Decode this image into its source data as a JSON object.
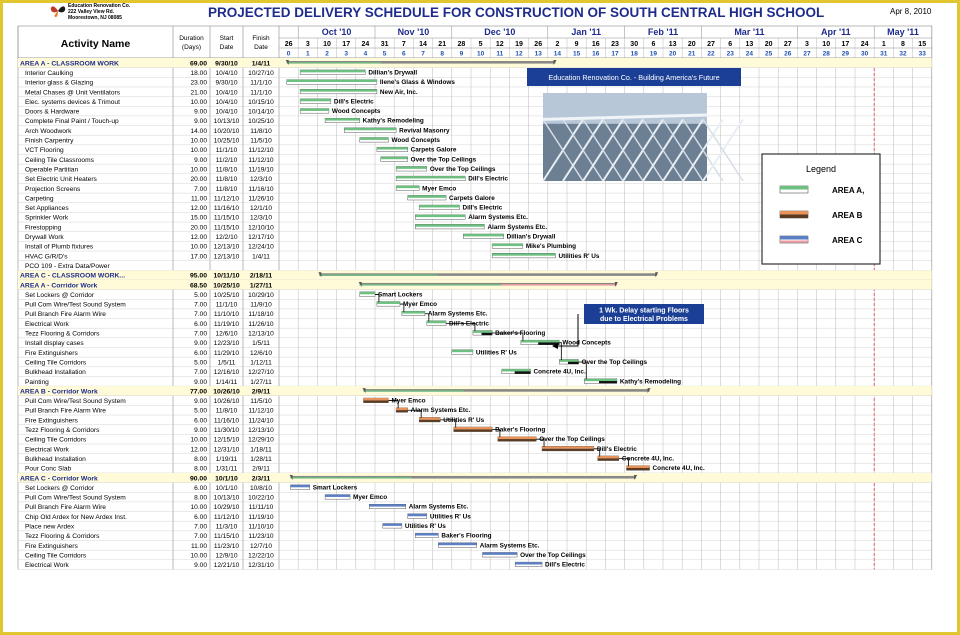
{
  "company": {
    "name": "Education Renovation Co.",
    "address": "222 Valley View Rd.",
    "city": "Moorestown, NJ  08085"
  },
  "title": "PROJECTED DELIVERY SCHEDULE FOR CONSTRUCTION OF SOUTH CENTRAL HIGH SCHOOL",
  "date": "Apr 8, 2010",
  "headers": {
    "activity": "Activity Name",
    "duration": "Duration (Days)",
    "start": "Start Date",
    "finish": "Finish Date"
  },
  "months": [
    {
      "label": "Oct '10",
      "col": 1
    },
    {
      "label": "Nov '10",
      "col": 5
    },
    {
      "label": "Dec '10",
      "col": 9
    },
    {
      "label": "Jan '11",
      "col": 14
    },
    {
      "label": "Feb '11",
      "col": 18
    },
    {
      "label": "Mar '11",
      "col": 22
    },
    {
      "label": "Apr '11",
      "col": 27
    },
    {
      "label": "May '11",
      "col": 31
    }
  ],
  "day_labels": [
    "26",
    "3",
    "10",
    "17",
    "24",
    "31",
    "7",
    "14",
    "21",
    "28",
    "5",
    "12",
    "19",
    "26",
    "2",
    "9",
    "16",
    "23",
    "30",
    "6",
    "13",
    "20",
    "27",
    "6",
    "13",
    "20",
    "27",
    "3",
    "10",
    "17",
    "24",
    "1",
    "8",
    "15"
  ],
  "week_labels": [
    "0",
    "1",
    "2",
    "3",
    "4",
    "5",
    "6",
    "7",
    "8",
    "9",
    "10",
    "11",
    "12",
    "13",
    "14",
    "15",
    "16",
    "17",
    "18",
    "19",
    "20",
    "21",
    "22",
    "23",
    "24",
    "25",
    "26",
    "27",
    "28",
    "29",
    "30",
    "31",
    "32",
    "33"
  ],
  "rows": [
    {
      "name": "AREA A - CLASSROOM WORK",
      "dur": "69.00",
      "start": "9/30/10",
      "finish": "1/4/11",
      "type": "summary",
      "bar": [
        0.4,
        14.4
      ],
      "label": ""
    },
    {
      "name": "Interior Caulking",
      "dur": "18.00",
      "start": "10/4/10",
      "finish": "10/27/10",
      "type": "a",
      "bar": [
        1.1,
        4.5
      ],
      "label": "Dillian's Drywall"
    },
    {
      "name": "Interior glass & Glazing",
      "dur": "23.00",
      "start": "9/30/10",
      "finish": "11/1/10",
      "type": "a",
      "bar": [
        0.4,
        5.1
      ],
      "label": "Ilene's Glass & Windows"
    },
    {
      "name": "Metal Chases @ Unit Ventilators",
      "dur": "21.00",
      "start": "10/4/10",
      "finish": "11/1/10",
      "type": "a",
      "bar": [
        1.1,
        5.1
      ],
      "label": "New Air, Inc."
    },
    {
      "name": "Elec. systems devices & Trimout",
      "dur": "10.00",
      "start": "10/4/10",
      "finish": "10/15/10",
      "type": "a",
      "bar": [
        1.1,
        2.7
      ],
      "label": "Dill's Electric"
    },
    {
      "name": "Doors & Hardware",
      "dur": "9.00",
      "start": "10/4/10",
      "finish": "10/14/10",
      "type": "a",
      "bar": [
        1.1,
        2.6
      ],
      "label": "Wood Concepts"
    },
    {
      "name": "Complete Final Paint / Touch-up",
      "dur": "9.00",
      "start": "10/13/10",
      "finish": "10/25/10",
      "type": "a",
      "bar": [
        2.4,
        4.2
      ],
      "label": "Kathy's Remodeling"
    },
    {
      "name": "Arch Woodwork",
      "dur": "14.00",
      "start": "10/20/10",
      "finish": "11/8/10",
      "type": "a",
      "bar": [
        3.4,
        6.1
      ],
      "label": "Revival Masonry"
    },
    {
      "name": "Finish Carpentry",
      "dur": "10.00",
      "start": "10/25/10",
      "finish": "11/5/10",
      "type": "a",
      "bar": [
        4.2,
        5.7
      ],
      "label": "Wood Concepts"
    },
    {
      "name": "VCT Flooring",
      "dur": "10.00",
      "start": "11/1/10",
      "finish": "11/12/10",
      "type": "a",
      "bar": [
        5.1,
        6.7
      ],
      "label": "Carpets Galore"
    },
    {
      "name": "Ceiling Tile Classrooms",
      "dur": "9.00",
      "start": "11/2/10",
      "finish": "11/12/10",
      "type": "a",
      "bar": [
        5.3,
        6.7
      ],
      "label": "Over the Top Ceilings"
    },
    {
      "name": "Operable Partitian",
      "dur": "10.00",
      "start": "11/8/10",
      "finish": "11/19/10",
      "type": "a",
      "bar": [
        6.1,
        7.7
      ],
      "label": "Over the Top Ceilings"
    },
    {
      "name": "Set Electric Unit Heaters",
      "dur": "20.00",
      "start": "11/8/10",
      "finish": "12/3/10",
      "type": "a",
      "bar": [
        6.1,
        9.7
      ],
      "label": "Dill's Electric"
    },
    {
      "name": "Projection Screens",
      "dur": "7.00",
      "start": "11/8/10",
      "finish": "11/16/10",
      "type": "a",
      "bar": [
        6.1,
        7.3
      ],
      "label": "Myer Emco"
    },
    {
      "name": "Carpeting",
      "dur": "11.00",
      "start": "11/12/10",
      "finish": "11/26/10",
      "type": "a",
      "bar": [
        6.7,
        8.7
      ],
      "label": "Carpets Galore"
    },
    {
      "name": "Set Appliances",
      "dur": "12.00",
      "start": "11/16/10",
      "finish": "12/1/10",
      "type": "a",
      "bar": [
        7.3,
        9.4
      ],
      "label": "Dill's Electric"
    },
    {
      "name": "Sprinkler Work",
      "dur": "15.00",
      "start": "11/15/10",
      "finish": "12/3/10",
      "type": "a",
      "bar": [
        7.1,
        9.7
      ],
      "label": "Alarm Systems Etc."
    },
    {
      "name": "Firestopping",
      "dur": "20.00",
      "start": "11/15/10",
      "finish": "12/10/10",
      "type": "a",
      "bar": [
        7.1,
        10.7
      ],
      "label": "Alarm Systems Etc."
    },
    {
      "name": "Drywall Work",
      "dur": "12.00",
      "start": "12/2/10",
      "finish": "12/17/10",
      "type": "a",
      "bar": [
        9.6,
        11.7
      ],
      "label": "Dillian's Drywall"
    },
    {
      "name": "Install of Plumb fixtures",
      "dur": "10.00",
      "start": "12/13/10",
      "finish": "12/24/10",
      "type": "a",
      "bar": [
        11.1,
        12.7
      ],
      "label": "Mike's Plumbing"
    },
    {
      "name": "HVAC G/R/D's",
      "dur": "17.00",
      "start": "12/13/10",
      "finish": "1/4/11",
      "type": "a",
      "bar": [
        11.1,
        14.4
      ],
      "label": "Utilities R' Us"
    },
    {
      "name": "PCO 109 - Extra Data/Power",
      "dur": "",
      "start": "",
      "finish": "",
      "type": "plain",
      "bar": null,
      "label": ""
    },
    {
      "name": "AREA C - CLASSROOM WORK...",
      "dur": "95.00",
      "start": "10/11/10",
      "finish": "2/18/11",
      "type": "summary",
      "bar": [
        2.1,
        19.7
      ],
      "label": ""
    },
    {
      "name": "AREA A - Corridor Work",
      "dur": "68.50",
      "start": "10/25/10",
      "finish": "1/27/11",
      "type": "summary2",
      "bar": [
        4.2,
        17.6
      ],
      "label": ""
    },
    {
      "name": "Set Lockers @ Corridor",
      "dur": "5.00",
      "start": "10/25/10",
      "finish": "10/29/10",
      "type": "a",
      "bar": [
        4.2,
        5.0
      ],
      "label": "Smart Lockers"
    },
    {
      "name": "Pull Com Wire/Test Sound System",
      "dur": "7.00",
      "start": "11/1/10",
      "finish": "11/9/10",
      "type": "a",
      "bar": [
        5.1,
        6.3
      ],
      "label": "Myer Emco"
    },
    {
      "name": "Pull Branch Fire Alarm Wire",
      "dur": "7.00",
      "start": "11/10/10",
      "finish": "11/18/10",
      "type": "a",
      "bar": [
        6.4,
        7.6
      ],
      "label": "Alarm Systems Etc."
    },
    {
      "name": "Electrical Work",
      "dur": "6.00",
      "start": "11/19/10",
      "finish": "11/26/10",
      "type": "a",
      "bar": [
        7.7,
        8.7
      ],
      "label": "Dill's Electric"
    },
    {
      "name": "Tezz Flooring & Corridors",
      "dur": "7.00",
      "start": "12/6/10",
      "finish": "12/13/10",
      "type": "crit",
      "bar": [
        10.1,
        11.1
      ],
      "label": "Baker's Flooring"
    },
    {
      "name": "Install display cases",
      "dur": "9.00",
      "start": "12/23/10",
      "finish": "1/5/11",
      "type": "crit",
      "bar": [
        12.6,
        14.6
      ],
      "label": "Wood Concepts"
    },
    {
      "name": "Fire Extinguishers",
      "dur": "6.00",
      "start": "11/29/10",
      "finish": "12/6/10",
      "type": "a",
      "bar": [
        9.0,
        10.1
      ],
      "label": "Utilities R' Us"
    },
    {
      "name": "Ceiling Tile Corridors",
      "dur": "5.00",
      "start": "1/5/11",
      "finish": "1/12/11",
      "type": "crit",
      "bar": [
        14.6,
        15.6
      ],
      "label": "Over the Top Ceilings"
    },
    {
      "name": "Bulkhead Installation",
      "dur": "7.00",
      "start": "12/16/10",
      "finish": "12/27/10",
      "type": "crit",
      "bar": [
        11.6,
        13.1
      ],
      "label": "Concrete 4U, Inc."
    },
    {
      "name": "Painting",
      "dur": "9.00",
      "start": "1/14/11",
      "finish": "1/27/11",
      "type": "crit",
      "bar": [
        15.9,
        17.6
      ],
      "label": "Kathy's Remodeling"
    },
    {
      "name": "AREA B - Corridor Work",
      "dur": "77.00",
      "start": "10/26/10",
      "finish": "2/9/11",
      "type": "summary",
      "bar": [
        4.4,
        19.3
      ],
      "label": ""
    },
    {
      "name": "Pull Com Wire/Test Sound System",
      "dur": "9.00",
      "start": "10/26/10",
      "finish": "11/5/10",
      "type": "b",
      "bar": [
        4.4,
        5.7
      ],
      "label": "Myer Emco"
    },
    {
      "name": "Pull Branch Fire Alarm Wire",
      "dur": "5.00",
      "start": "11/8/10",
      "finish": "11/12/10",
      "type": "b",
      "bar": [
        6.1,
        6.7
      ],
      "label": "Alarm Systems Etc."
    },
    {
      "name": "Fire Extinguishers",
      "dur": "6.00",
      "start": "11/16/10",
      "finish": "11/24/10",
      "type": "b",
      "bar": [
        7.3,
        8.4
      ],
      "label": "Utilities R' Us"
    },
    {
      "name": "Tezz Flooring & Corridors",
      "dur": "9.00",
      "start": "11/30/10",
      "finish": "12/13/10",
      "type": "b",
      "bar": [
        9.1,
        11.1
      ],
      "label": "Baker's Flooring"
    },
    {
      "name": "Ceiling Tile Corridors",
      "dur": "10.00",
      "start": "12/15/10",
      "finish": "12/29/10",
      "type": "b",
      "bar": [
        11.4,
        13.4
      ],
      "label": "Over the Top Ceilings"
    },
    {
      "name": "Electrical Work",
      "dur": "12.00",
      "start": "12/31/10",
      "finish": "1/18/11",
      "type": "b",
      "bar": [
        13.7,
        16.4
      ],
      "label": "Dill's Electric"
    },
    {
      "name": "Bulkhead Installation",
      "dur": "8.00",
      "start": "1/19/11",
      "finish": "1/28/11",
      "type": "b",
      "bar": [
        16.6,
        17.7
      ],
      "label": "Concrete 4U, Inc."
    },
    {
      "name": "Pour Conc Slab",
      "dur": "8.00",
      "start": "1/31/11",
      "finish": "2/9/11",
      "type": "b",
      "bar": [
        18.1,
        19.3
      ],
      "label": "Concrete 4U, Inc."
    },
    {
      "name": "AREA C - Corridor Work",
      "dur": "90.00",
      "start": "10/1/10",
      "finish": "2/3/11",
      "type": "summary",
      "bar": [
        0.6,
        18.6
      ],
      "label": ""
    },
    {
      "name": "Set Lockers @ Corridor",
      "dur": "6.00",
      "start": "10/1/10",
      "finish": "10/8/10",
      "type": "c",
      "bar": [
        0.6,
        1.6
      ],
      "label": "Smart Lockers"
    },
    {
      "name": "Pull Com Wire/Test Sound System",
      "dur": "8.00",
      "start": "10/13/10",
      "finish": "10/22/10",
      "type": "c",
      "bar": [
        2.4,
        3.7
      ],
      "label": "Myer Emco"
    },
    {
      "name": "Pull Branch Fire Alarm Wire",
      "dur": "10.00",
      "start": "10/29/10",
      "finish": "11/11/10",
      "type": "c",
      "bar": [
        4.7,
        6.6
      ],
      "label": "Alarm Systems Etc."
    },
    {
      "name": "Chip Old Ardex for New Ardex Inst.",
      "dur": "6.00",
      "start": "11/12/10",
      "finish": "11/19/10",
      "type": "c",
      "bar": [
        6.7,
        7.7
      ],
      "label": "Utilities R' Us"
    },
    {
      "name": "Place new Ardex",
      "dur": "7.00",
      "start": "11/3/10",
      "finish": "11/10/10",
      "type": "c",
      "bar": [
        5.4,
        6.4
      ],
      "label": "Utilities R' Us"
    },
    {
      "name": "Tezz Flooring & Corridors",
      "dur": "7.00",
      "start": "11/15/10",
      "finish": "11/23/10",
      "type": "c",
      "bar": [
        7.1,
        8.3
      ],
      "label": "Baker's Flooring"
    },
    {
      "name": "Fire Extinguishers",
      "dur": "11.00",
      "start": "11/23/10",
      "finish": "12/7/10",
      "type": "c",
      "bar": [
        8.3,
        10.3
      ],
      "label": "Alarm Systems Etc."
    },
    {
      "name": "Ceiling Tile Corridors",
      "dur": "10.00",
      "start": "12/9/10",
      "finish": "12/22/10",
      "type": "c",
      "bar": [
        10.6,
        12.4
      ],
      "label": "Over the Top Ceilings"
    },
    {
      "name": "Electrical Work",
      "dur": "9.00",
      "start": "12/21/10",
      "finish": "12/31/10",
      "type": "c",
      "bar": [
        12.3,
        13.7
      ],
      "label": "Dill's Electric"
    }
  ],
  "banner": "Education Renovation Co. - Building America's Future",
  "callout": {
    "line1": "1 Wk. Delay starting Floors",
    "line2": "due to Electrical Problems"
  },
  "legend": {
    "title": "Legend",
    "items": [
      "AREA A,",
      "AREA B",
      "AREA C"
    ]
  },
  "colors": {
    "title": "#1f2b8c",
    "month": "#1f2b8c",
    "areaA": "#6cc080",
    "areaB": "#e8935a",
    "areaC": "#5b7fc2",
    "summaryBg": "#fffbd9",
    "callout": "#1c3f96",
    "banner": "#1c3f96",
    "critical": "#101010"
  },
  "chart_data": {
    "type": "gantt",
    "title": "PROJECTED DELIVERY SCHEDULE FOR CONSTRUCTION OF SOUTH CENTRAL HIGH SCHOOL",
    "xlabel": "",
    "ylabel": "",
    "x_range": [
      "9/26/10",
      "5/21/11"
    ],
    "legend": [
      "AREA A,",
      "AREA B",
      "AREA C"
    ],
    "series_ref": "rows"
  }
}
